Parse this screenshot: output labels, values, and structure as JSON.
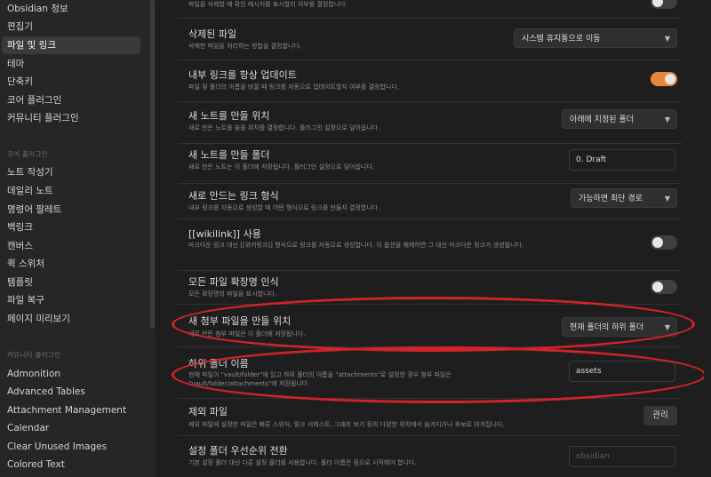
{
  "sidebar": {
    "top_items": [
      "Obsidian 정보",
      "편집기",
      "파일 및 링크",
      "테마",
      "단축키",
      "코어 플러그인",
      "커뮤니티 플러그인"
    ],
    "active_index": 2,
    "core_group_label": "코어 플러그인",
    "core_items": [
      "노트 작성기",
      "데일리 노트",
      "명령어 팔레트",
      "백링크",
      "캔버스",
      "퀵 스위처",
      "템플릿",
      "파일 복구",
      "페이지 미리보기"
    ],
    "community_group_label": "커뮤니티 플러그인",
    "community_items": [
      "Admonition",
      "Advanced Tables",
      "Attachment Management",
      "Calendar",
      "Clear Unused Images",
      "Colored Text"
    ]
  },
  "settings": {
    "top_desc": "파일을 삭제할 때 확인 메시지를 표시할지 여부를 결정합니다.",
    "deleted_files": {
      "title": "삭제된 파일",
      "desc": "삭제한 파일을 처리하는 방법을 결정합니다.",
      "value": "시스템 휴지통으로 이동"
    },
    "auto_update_links": {
      "title": "내부 링크를 항상 업데이트",
      "desc": "파일 및 폴더의 이름을 바꿀 때 링크를 자동으로 업데이트할지 여부를 결정합니다."
    },
    "new_note_location": {
      "title": "새 노트를 만들 위치",
      "desc": "새로 만든 노트를 놓을 위치를 결정합니다. 플러그인 설정으로 덮어씁니다.",
      "value": "아래에 지정된 폴더"
    },
    "new_note_folder": {
      "title": "새 노트를 만들 폴더",
      "desc": "새로 만든 노트는 이 폴더에 저장됩니다. 플러그인 설정으로 덮어씁니다.",
      "value": "0. Draft"
    },
    "new_link_format": {
      "title": "새로 만드는 링크 형식",
      "desc": "내부 링크를 자동으로 생성할 때 어떤 형식으로 링크를 만들지 결정합니다.",
      "value": "가능하면 최단 경로"
    },
    "wikilink": {
      "title": "[[wikilink]] 사용",
      "desc": "마크다운 링크 대신 [[위키링크]] 형식으로 링크를 자동으로 생성합니다. 이 옵션을 해제하면 그 대신 마크다운 링크가 생성됩니다."
    },
    "detect_extensions": {
      "title": "모든 파일 확장명 인식",
      "desc": "모든 확장명의 파일을 표시합니다."
    },
    "attachment_location": {
      "title": "새 첨부 파일을 만들 위치",
      "desc": "새로 만든 첨부 파일은 이 폴더에 저장됩니다.",
      "value": "현재 폴더의 하위 폴더"
    },
    "subfolder_name": {
      "title": "하위 폴더 이름",
      "desc": "현재 파일이 \"vault/folder\"에 있고 하위 폴더의 이름을 \"attachments\"로 설정한 경우 첨부 파일은 \"vault/folder/attachments\"에 저장됩니다.",
      "value": "assets"
    },
    "excluded_files": {
      "title": "제외 파일",
      "desc": "제외 파일에 설정한 파일은 빠른 스위처, 링크 서제스트, 그래프 보기 등의 다양한 위치에서 숨겨지거나 후보로 여겨집니다.",
      "button": "관리"
    },
    "override_config": {
      "title": "설정 폴더 우선순위 전환",
      "desc": "기본 설정 폴더 대신 다른 설정 폴더를 사용합니다. 폴더 이름은 점으로 시작해야 합니다.",
      "placeholder": "obsidian"
    }
  },
  "colors": {
    "accent": "#e8873a",
    "annotation": "#d2232a",
    "background": "#1e1e1e",
    "sidebar": "#262626"
  },
  "icons": [
    "chevron-down-icon"
  ]
}
